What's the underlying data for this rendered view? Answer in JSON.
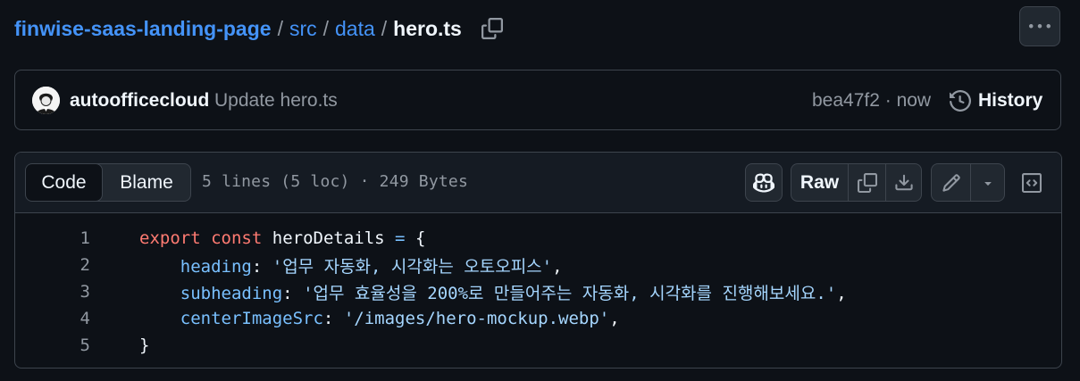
{
  "breadcrumb": {
    "repo": "finwise-saas-landing-page",
    "sep": "/",
    "dir1": "src",
    "dir2": "data",
    "file": "hero.ts"
  },
  "commit": {
    "author": "autoofficecloud",
    "message": "Update hero.ts",
    "meta": "bea47f2 · now",
    "history_label": "History"
  },
  "file_header": {
    "tabs": [
      "Code",
      "Blame"
    ],
    "active_tab": "Code",
    "info": "5 lines (5 loc) · 249 Bytes",
    "raw_label": "Raw"
  },
  "code": {
    "line_numbers": [
      "1",
      "2",
      "3",
      "4",
      "5"
    ],
    "line1": {
      "kw1": "export",
      "kw2": "const",
      "name": "heroDetails",
      "op": "=",
      "brace": "{"
    },
    "line2": {
      "key": "heading",
      "colon": ":",
      "value": "'업무 자동화, 시각화는 오토오피스'",
      "comma": ","
    },
    "line3": {
      "key": "subheading",
      "colon": ":",
      "value": "'업무 효율성을 200%로 만들어주는 자동화, 시각화를 진행해보세요.'",
      "comma": ","
    },
    "line4": {
      "key": "centerImageSrc",
      "colon": ":",
      "value": "'/images/hero-mockup.webp'",
      "comma": ","
    },
    "line5": {
      "brace": "}"
    }
  },
  "colors": {
    "background": "#0d1117",
    "link": "#4493f8",
    "keyword": "#ff7b72",
    "property": "#79c0ff",
    "string": "#a5d6ff",
    "muted": "#9198a1",
    "border": "#3d444d"
  },
  "icons": [
    "copy-icon",
    "kebab-icon",
    "history-icon",
    "copilot-icon",
    "download-icon",
    "pencil-icon",
    "chevron-down-icon",
    "code-square-icon"
  ]
}
